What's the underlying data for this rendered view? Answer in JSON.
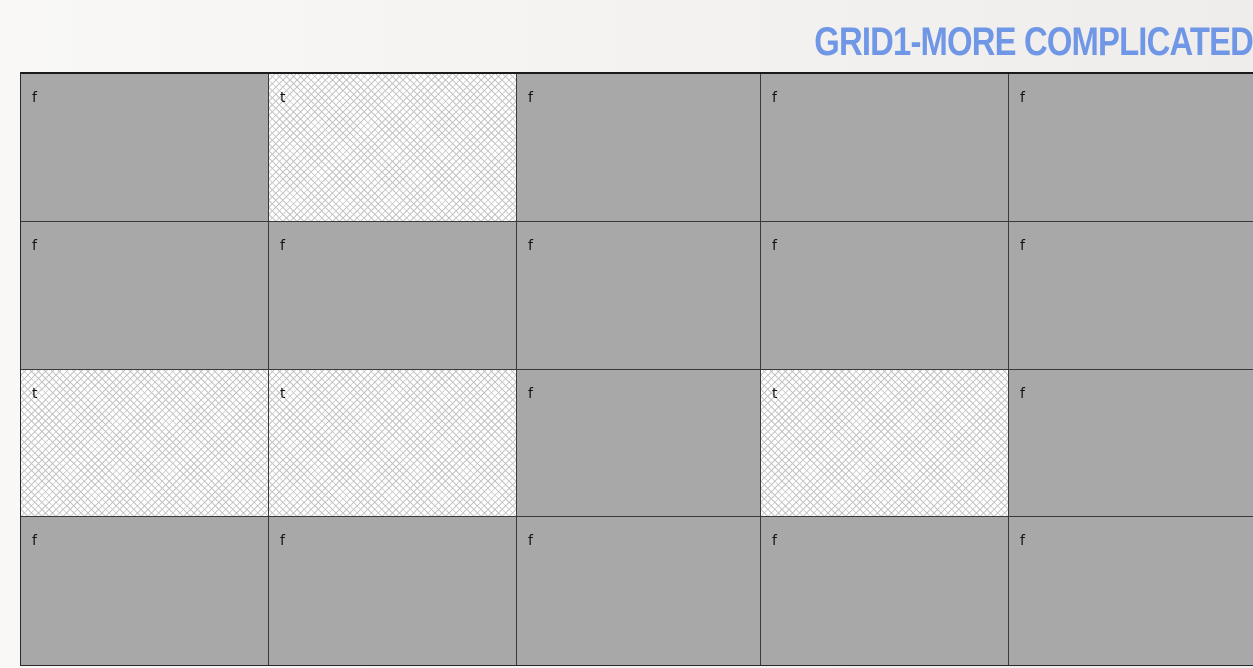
{
  "title": "GRID1-MORE COMPLICATED",
  "colors": {
    "title": "#6f97e6",
    "cell_false": "#a8a8a8",
    "cell_true_pattern": "#c4c4c4",
    "grid_line": "#3a3a3a"
  },
  "grid": {
    "rows": [
      {
        "cells": [
          {
            "value": "f"
          },
          {
            "value": "t"
          },
          {
            "value": "f"
          },
          {
            "value": "f"
          },
          {
            "value": "f"
          }
        ]
      },
      {
        "cells": [
          {
            "value": "f"
          },
          {
            "value": "f"
          },
          {
            "value": "f"
          },
          {
            "value": "f"
          },
          {
            "value": "f"
          }
        ]
      },
      {
        "cells": [
          {
            "value": "t"
          },
          {
            "value": "t"
          },
          {
            "value": "f"
          },
          {
            "value": "t"
          },
          {
            "value": "f"
          }
        ]
      },
      {
        "cells": [
          {
            "value": "f"
          },
          {
            "value": "f"
          },
          {
            "value": "f"
          },
          {
            "value": "f"
          },
          {
            "value": "f"
          }
        ]
      }
    ]
  }
}
